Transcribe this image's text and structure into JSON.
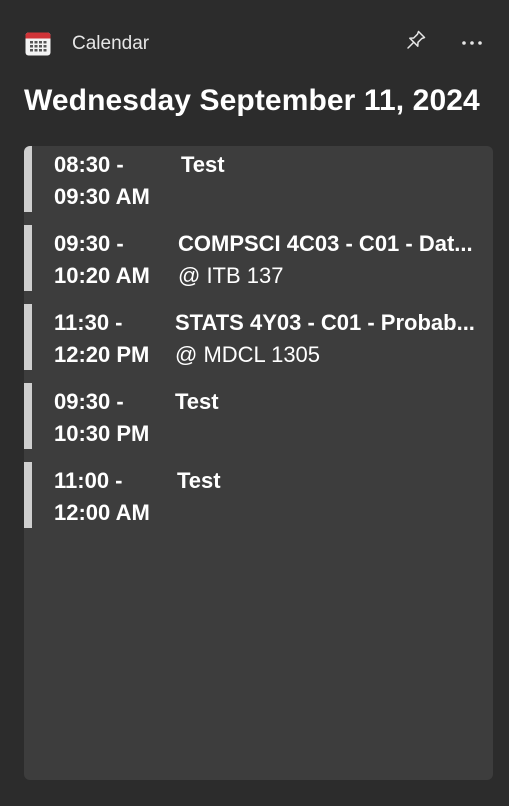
{
  "app": {
    "title": "Calendar",
    "icon": "calendar-icon",
    "pin_icon": "pin-icon",
    "more_icon": "more-icon",
    "accent_color": "#d13438"
  },
  "date_heading": "Wednesday September 11, 2024",
  "events": [
    {
      "time_start": "08:30 -",
      "time_end": "09:30 AM",
      "title": "Test",
      "location": ""
    },
    {
      "time_start": "09:30 -",
      "time_end": "10:20 AM",
      "title": "COMPSCI 4C03 - C01 - Dat...",
      "location": "@ ITB 137"
    },
    {
      "time_start": "11:30 -",
      "time_end": "12:20 PM",
      "title": "STATS 4Y03 - C01 - Probab...",
      "location": "@ MDCL 1305"
    },
    {
      "time_start": "09:30 -",
      "time_end": "10:30 PM",
      "title": "Test",
      "location": ""
    },
    {
      "time_start": "11:00 -",
      "time_end": "12:00 AM",
      "title": "Test",
      "location": ""
    }
  ]
}
